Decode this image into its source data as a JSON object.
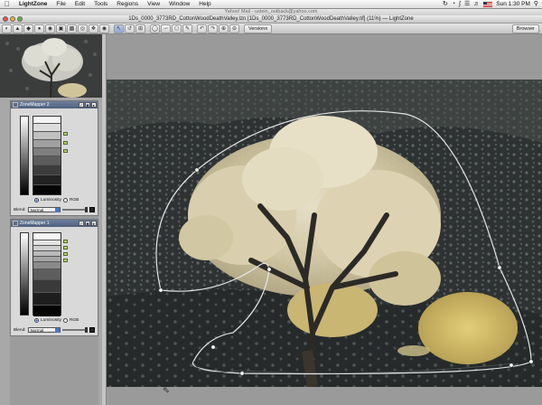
{
  "menubar": {
    "app_name": "LightZone",
    "items": [
      "File",
      "Edit",
      "Tools",
      "Regions",
      "View",
      "Window",
      "Help"
    ],
    "clock": "Sun 1:30 PM"
  },
  "background_window": {
    "title": "Yahoo! Mail - ustein_outback@yahoo.com"
  },
  "window": {
    "title": "1Ds_0000_3773RD_CottonWoodDeathValley.lzn [1Ds_0000_3773RD_CottonWoodDeathValley.tif] (11%) — LightZone"
  },
  "toolbar": {
    "versions_label": "Versions",
    "browser_label": "Browser"
  },
  "tools": [
    {
      "title": "ZoneMapper 2",
      "luminosity_label": "Luminosity",
      "rgb_label": "RGB",
      "blend_label": "Blend:",
      "blend_value": "Normal"
    },
    {
      "title": "ZoneMapper 1",
      "luminosity_label": "Luminosity",
      "rgb_label": "RGB",
      "blend_label": "Blend:",
      "blend_value": "Normal"
    }
  ],
  "colors": {
    "accent": "#4e607e",
    "canvas_bg": "#9a9a9a",
    "pin": "#b8d070"
  }
}
